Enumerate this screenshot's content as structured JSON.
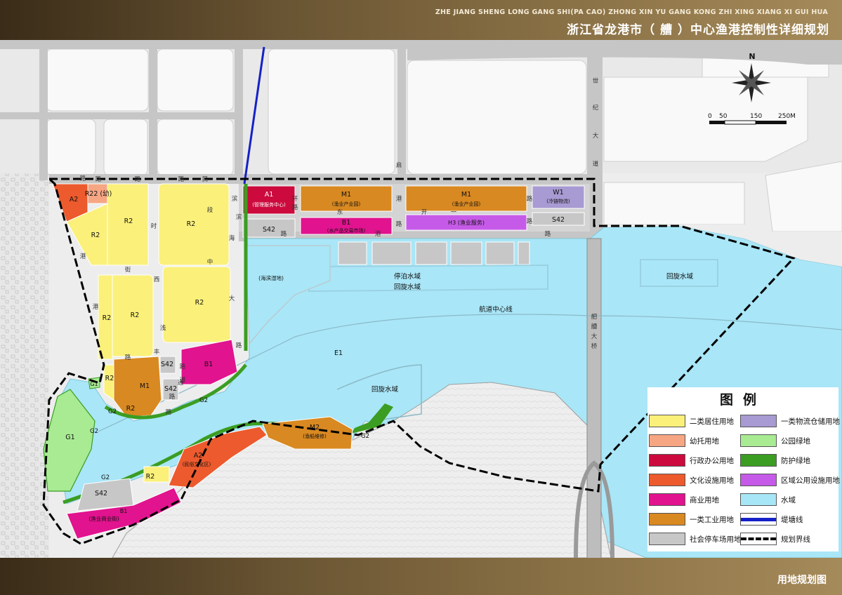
{
  "header": {
    "pinyin": "ZHE JIANG SHENG LONG GANG SHI(PA CAO) ZHONG XIN YU GANG KONG ZHI XING XIANG XI GUI HUA",
    "title": "浙江省龙港市（ 艚 ）中心渔港控制性详细规划"
  },
  "footer": {
    "subtitle": "用地规划图"
  },
  "compass": {
    "north_label": "N"
  },
  "scale_bar": {
    "labels": [
      "0",
      "50",
      "150",
      "250M"
    ]
  },
  "parcels": {
    "a2_nw": "A2",
    "r22": "R22 (幼)",
    "r2_a": "R2",
    "r2_b": "R2",
    "r2_c": "R2",
    "r2_d": "R2",
    "r2_e": "R2",
    "r2_f": "R2",
    "r2_g": "R2",
    "r2_h": "R2",
    "r2_i": "R2",
    "a1": "A1",
    "a1_sub": "(管理服务中心)",
    "m1_a": "M1",
    "m1_a_sub": "(渔业产业园)",
    "m1_b": "M1",
    "m1_b_sub": "(渔业产业园)",
    "w1": "W1",
    "w1_sub": "(冷链物流)",
    "s42_a": "S42",
    "s42_b": "S42",
    "s42_c": "S42",
    "s42_d": "S42",
    "s42_e": "S42",
    "b1_a": "B1",
    "b1_a_sub": "(水产品交易市场)",
    "h3": "H3 (渔业服务)",
    "b1_b": "B1",
    "m1_c": "M1",
    "wetland": "(海滨湿地)",
    "g1_a": "G1",
    "g1_b": "G1",
    "g2_a": "G2",
    "g2_b": "G2",
    "g2_c": "G2",
    "g2_d": "G2",
    "g2_e": "G2",
    "a2_s": "A2",
    "a2_s_sub": "(民俗文化区)",
    "m2": "M2",
    "m2_sub": "(渔船维修)",
    "b1_c_sub": "(渔业商业街)",
    "b1_c": "B1",
    "e1": "E1"
  },
  "water_labels": {
    "berth": "停泊水域",
    "turn_a": "回旋水域",
    "channel": "航道中心线",
    "turn_b": "回旋水域",
    "turn_c": "回旋水域"
  },
  "road_labels": [
    "路",
    "滨",
    "港",
    "路",
    "路",
    "时",
    "民",
    "路",
    "海",
    "中",
    "大",
    "段",
    "街",
    "港",
    "西",
    "道",
    "丰",
    "浅",
    "路",
    "路",
    "路",
    "通",
    "路",
    "滨",
    "路",
    "港",
    "路",
    "启",
    "港",
    "路",
    "世",
    "纪",
    "大",
    "道",
    "路",
    "路",
    "环",
    "路",
    "东",
    "开",
    "一",
    "路"
  ],
  "bridge_label": [
    "舥",
    "艚",
    "大",
    "桥"
  ],
  "legend": {
    "title": "图例",
    "items": [
      {
        "label": "二类居住用地",
        "color": "#fbf07a"
      },
      {
        "label": "一类物流仓储用地",
        "color": "#a89ad2"
      },
      {
        "label": "幼托用地",
        "color": "#f6a683"
      },
      {
        "label": "公园绿地",
        "color": "#a8eb93"
      },
      {
        "label": "行政办公用地",
        "color": "#cc0a3d"
      },
      {
        "label": "防护绿地",
        "color": "#3b9d22"
      },
      {
        "label": "文化设施用地",
        "color": "#ec5a2d"
      },
      {
        "label": "区域公用设施用地",
        "color": "#c65ae8"
      },
      {
        "label": "商业用地",
        "color": "#e1138e"
      },
      {
        "label": "水域",
        "color": "#a7e6f6"
      },
      {
        "label": "一类工业用地",
        "color": "#d98921"
      },
      {
        "label": "堤塘线",
        "color": "#1521c8"
      },
      {
        "label": "社会停车场用地",
        "color": "#c7c7c7"
      },
      {
        "label": "规划界线",
        "color": "#000000"
      }
    ]
  }
}
